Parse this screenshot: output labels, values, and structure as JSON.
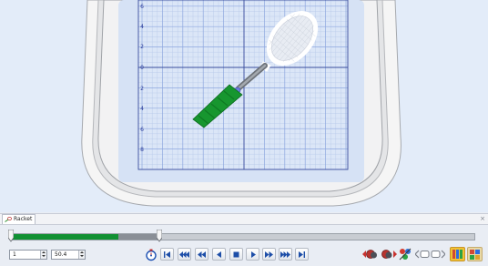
{
  "canvas": {
    "y_axis_labels": [
      "6",
      "4",
      "2",
      "0",
      "2",
      "4",
      "6",
      "8"
    ],
    "colors": {
      "background": "#e3ecf9",
      "grid_major": "#8ea7df",
      "grid_minor": "#b8c8ea",
      "hoop_frame": "#f4f4f4",
      "racket_handle": "#1a9a32",
      "racket_shaft": "#7d8289",
      "racket_frame": "#ffffff"
    }
  },
  "design_tab": {
    "label": "Racket",
    "close_symbol": "×"
  },
  "stitch_slider": {
    "progress": 0.23,
    "colors": {
      "filled": "#119133",
      "partial": "#8a8f96",
      "track": "#c8ccd2"
    }
  },
  "controls": {
    "start_stitch_value": "1",
    "end_stitch_value": "50.4",
    "playback_buttons": [
      "first-stitch",
      "previous-color",
      "previous-block",
      "previous-stitch",
      "stop",
      "play",
      "next-stitch",
      "next-block",
      "next-color",
      "last-stitch"
    ]
  }
}
